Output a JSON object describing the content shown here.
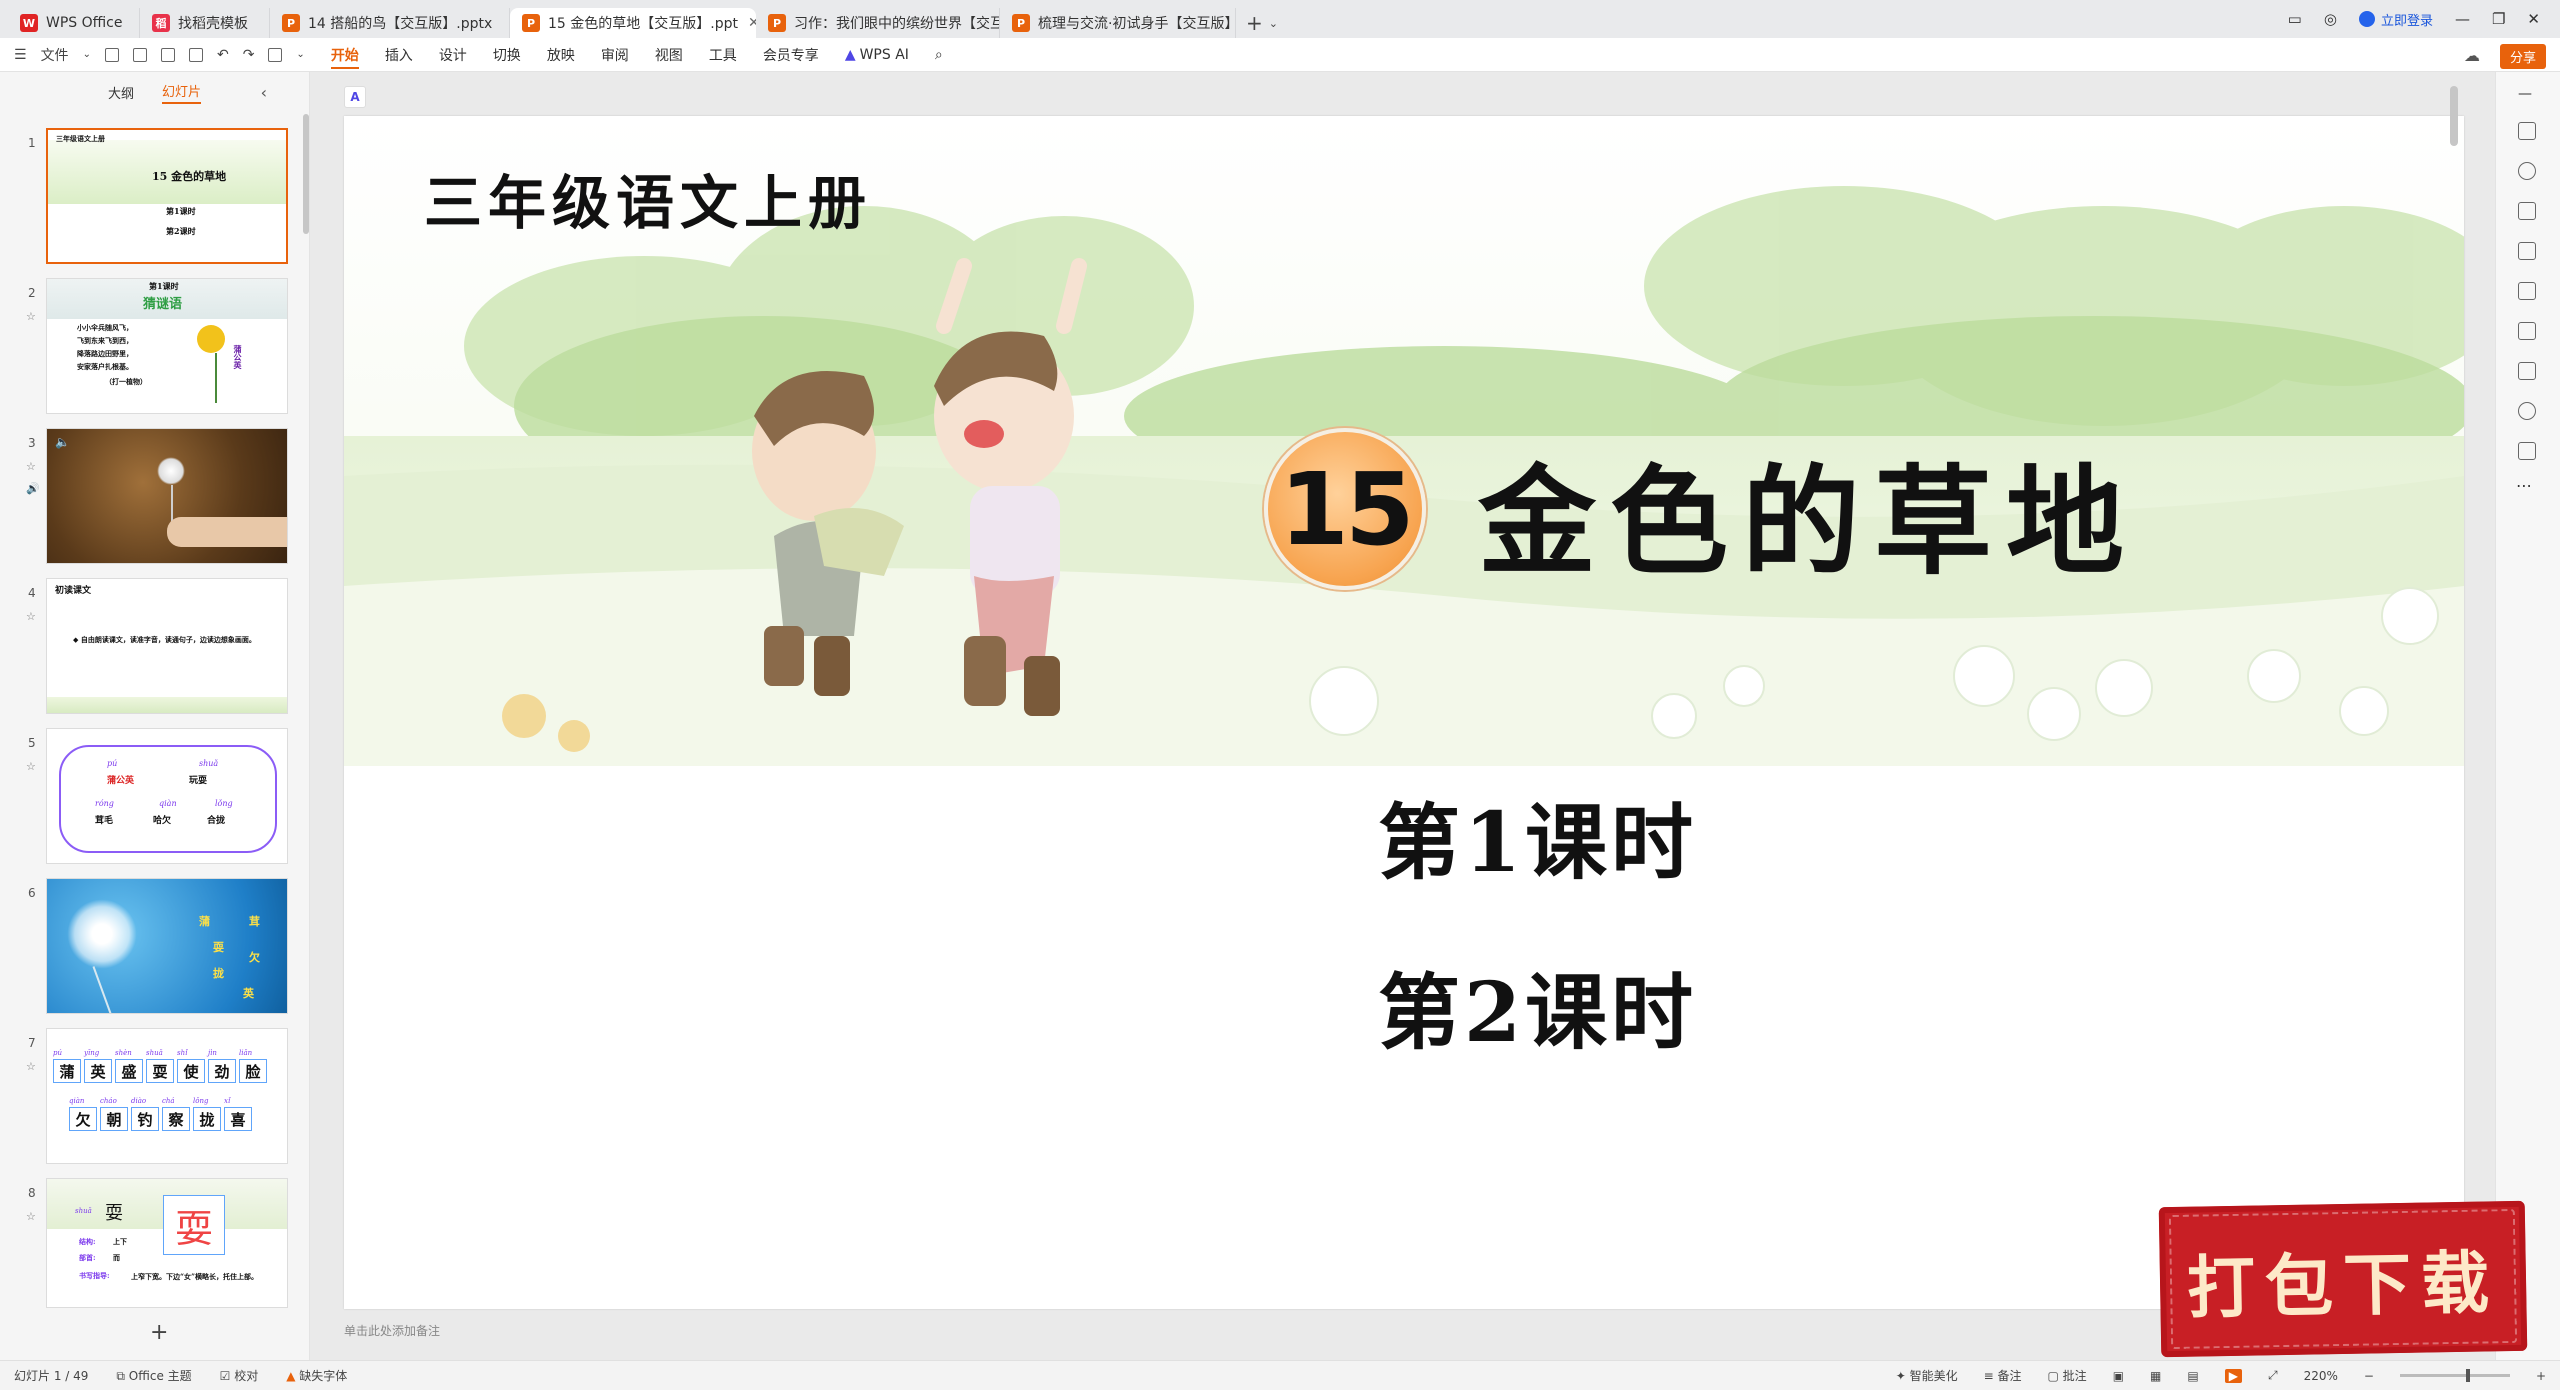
{
  "tabs": [
    {
      "label": "WPS Office",
      "icon": "wps-logo-icon",
      "active": false
    },
    {
      "label": "找稻壳模板",
      "icon": "template-icon",
      "active": false
    },
    {
      "label": "14 搭船的鸟【交互版】.pptx",
      "icon": "pptx-file-icon",
      "active": false
    },
    {
      "label": "15 金色的草地【交互版】.ppt",
      "icon": "pptx-file-icon",
      "active": true
    },
    {
      "label": "习作：我们眼中的缤纷世界【交互版】",
      "icon": "pptx-file-icon",
      "active": false
    },
    {
      "label": "梳理与交流·初试身手【交互版】.pptx",
      "icon": "pptx-file-icon",
      "active": false
    }
  ],
  "window": {
    "login_label": "立即登录"
  },
  "ribbon": {
    "file_label": "文件",
    "tabs": [
      "开始",
      "插入",
      "设计",
      "切换",
      "放映",
      "审阅",
      "视图",
      "工具",
      "会员专享",
      "WPS AI"
    ],
    "active_tab": "开始",
    "share_label": "分享"
  },
  "leftpanel": {
    "tab_outline": "大纲",
    "tab_slides": "幻灯片",
    "slides": [
      {
        "num": "1",
        "grade": "三年级语文上册",
        "title": "15 金色的草地",
        "l1": "第1课时",
        "l2": "第2课时"
      },
      {
        "num": "2",
        "head": "第1课时",
        "sub": "猜谜语",
        "lines": [
          "小小伞兵随风飞，",
          "飞到东来飞到西，",
          "降落路边田野里，",
          "安家落户扎根基。",
          "（打一植物）"
        ],
        "answer": "蒲公英"
      },
      {
        "num": "3"
      },
      {
        "num": "4",
        "head": "初读课文",
        "bullet": "◆ 自由朗读课文，读准字音，读通句子，边读边想象画面。"
      },
      {
        "num": "5",
        "pinyin": [
          "pú",
          "shuǎ",
          "róng",
          "qiàn",
          "lǒng"
        ],
        "words": [
          "蒲公英",
          "玩耍",
          "茸毛",
          "哈欠",
          "合拢"
        ]
      },
      {
        "num": "6",
        "chars": [
          "蒲",
          "耍",
          "拢",
          "茸",
          "欠",
          "英"
        ]
      },
      {
        "num": "7",
        "pinyin_row1": [
          "pú",
          "yīng",
          "shèn",
          "shuǎ",
          "shǐ",
          "jìn",
          "liǎn"
        ],
        "row1": [
          "蒲",
          "英",
          "盛",
          "耍",
          "使",
          "劲",
          "脸"
        ],
        "pinyin_row2": [
          "qiàn",
          "cháo",
          "diào",
          "chá",
          "lǒng",
          "xǐ"
        ],
        "row2": [
          "欠",
          "朝",
          "钓",
          "察",
          "拢",
          "喜"
        ]
      },
      {
        "num": "8",
        "py": "shuǎ",
        "char": "耍",
        "big": "耍",
        "k1": "结构:",
        "v1": "上下",
        "k2": "部首:",
        "v2": "而",
        "k3": "书写指导:",
        "v3": "上窄下宽。下边“女”横略长，托住上部。"
      }
    ]
  },
  "slide": {
    "grade": "三年级语文上册",
    "number": "15",
    "title": "金色的草地",
    "lesson1": "第1课时",
    "lesson2": "第2课时"
  },
  "notes_placeholder": "单击此处添加备注",
  "stamp_label": "打包下载",
  "status": {
    "slide_counter": "幻灯片 1 / 49",
    "theme": "Office 主题",
    "proof": "校对",
    "missing_font": "缺失字体",
    "smart": "智能美化",
    "notes": "备注",
    "comment": "批注",
    "zoom": "220%"
  },
  "colors": {
    "accent": "#e8620c",
    "stamp_red": "#c81f25"
  }
}
